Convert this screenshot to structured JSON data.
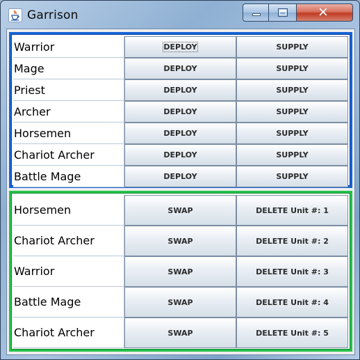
{
  "window": {
    "title": "Garrison",
    "controls": {
      "minimize_icon": "minimize-icon",
      "maximize_icon": "maximize-icon",
      "close_icon": "close-icon",
      "close_glyph": "✕"
    },
    "app_icon": "java-coffee-cup-icon"
  },
  "colors": {
    "top_panel_border": "#1565d8",
    "bottom_panel_border": "#24c24a",
    "close_button": "#c13b23"
  },
  "available_units": [
    {
      "name": "Warrior",
      "deploy_label": "DEPLOY",
      "supply_label": "SUPPLY"
    },
    {
      "name": "Mage",
      "deploy_label": "DEPLOY",
      "supply_label": "SUPPLY"
    },
    {
      "name": "Priest",
      "deploy_label": "DEPLOY",
      "supply_label": "SUPPLY"
    },
    {
      "name": "Archer",
      "deploy_label": "DEPLOY",
      "supply_label": "SUPPLY"
    },
    {
      "name": "Horsemen",
      "deploy_label": "DEPLOY",
      "supply_label": "SUPPLY"
    },
    {
      "name": "Chariot Archer",
      "deploy_label": "DEPLOY",
      "supply_label": "SUPPLY"
    },
    {
      "name": "Battle Mage",
      "deploy_label": "DEPLOY",
      "supply_label": "SUPPLY"
    }
  ],
  "garrison_units": [
    {
      "name": "Horsemen",
      "swap_label": "SWAP",
      "delete_label": "DELETE Unit #: 1"
    },
    {
      "name": "Chariot Archer",
      "swap_label": "SWAP",
      "delete_label": "DELETE Unit #: 2"
    },
    {
      "name": "Warrior",
      "swap_label": "SWAP",
      "delete_label": "DELETE Unit #: 3"
    },
    {
      "name": "Battle Mage",
      "swap_label": "SWAP",
      "delete_label": "DELETE Unit #: 4"
    },
    {
      "name": "Chariot Archer",
      "swap_label": "SWAP",
      "delete_label": "DELETE Unit #: 5"
    }
  ]
}
